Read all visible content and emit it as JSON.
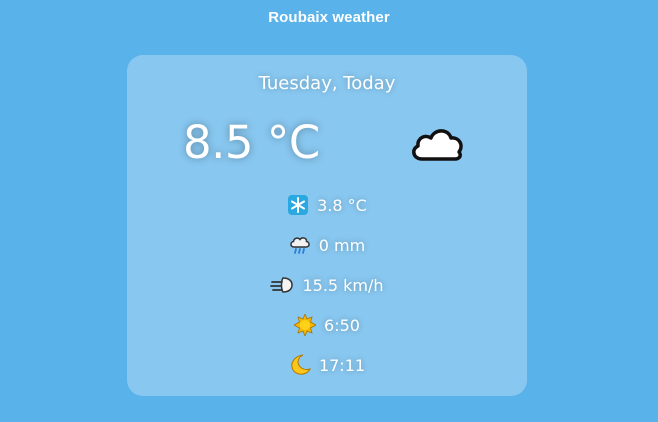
{
  "header": {
    "title": "Roubaix weather"
  },
  "card": {
    "date": "Tuesday, Today",
    "temperature": "8.5 °C",
    "condition_icon": "cloud-icon",
    "details": [
      {
        "icon": "snowflake-icon",
        "value": "3.8 °C"
      },
      {
        "icon": "rain-cloud-icon",
        "value": "0 mm"
      },
      {
        "icon": "wind-icon",
        "value": "15.5 km/h"
      },
      {
        "icon": "sun-icon",
        "value": "6:50"
      },
      {
        "icon": "crescent-moon-icon",
        "value": "17:11"
      }
    ]
  },
  "colors": {
    "background": "#5ab2eb",
    "card": "#8cc9f0",
    "text": "#ffffff"
  }
}
